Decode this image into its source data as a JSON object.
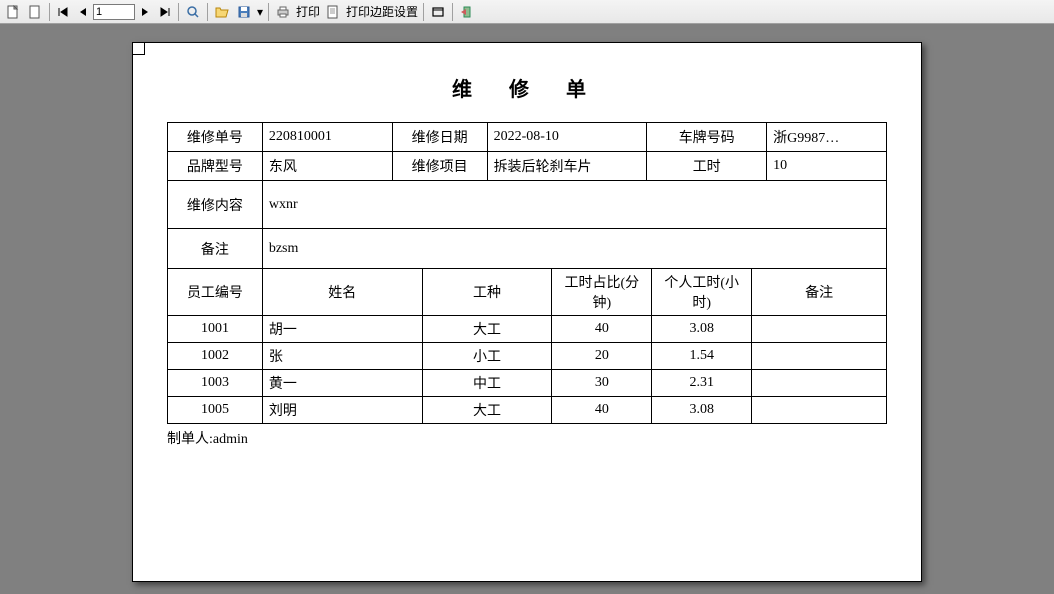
{
  "toolbar": {
    "page_input": "1",
    "print_label": "打印",
    "margin_label": "打印边距设置"
  },
  "doc": {
    "title": "维 修 单",
    "labels": {
      "order_no": "维修单号",
      "repair_date": "维修日期",
      "plate_no": "车牌号码",
      "brand_model": "品牌型号",
      "repair_item": "维修项目",
      "work_hours": "工时",
      "repair_content": "维修内容",
      "remark": "备注"
    },
    "values": {
      "order_no": "220810001",
      "repair_date": "2022-08-10",
      "plate_no": "浙G9987…",
      "brand_model": "东风",
      "repair_item": "拆装后轮刹车片",
      "work_hours": "10",
      "repair_content": "wxnr",
      "remark": "bzsm"
    },
    "emp_headers": {
      "emp_no": "员工编号",
      "name": "姓名",
      "job_type": "工种",
      "ratio": "工时占比(分钟)",
      "personal_hours": "个人工时(小时)",
      "remark": "备注"
    },
    "employees": [
      {
        "no": "1001",
        "name": "胡一  ",
        "job": "大工",
        "ratio": "40",
        "hours": "3.08",
        "remark": ""
      },
      {
        "no": "1002",
        "name": "张",
        "job": "小工",
        "ratio": "20",
        "hours": "1.54",
        "remark": ""
      },
      {
        "no": "1003",
        "name": "黄一  ",
        "job": "中工",
        "ratio": "30",
        "hours": "2.31",
        "remark": ""
      },
      {
        "no": "1005",
        "name": "刘明   ",
        "job": "大工",
        "ratio": "40",
        "hours": "3.08",
        "remark": ""
      }
    ],
    "footer_label": "制单人:",
    "footer_value": "admin"
  }
}
